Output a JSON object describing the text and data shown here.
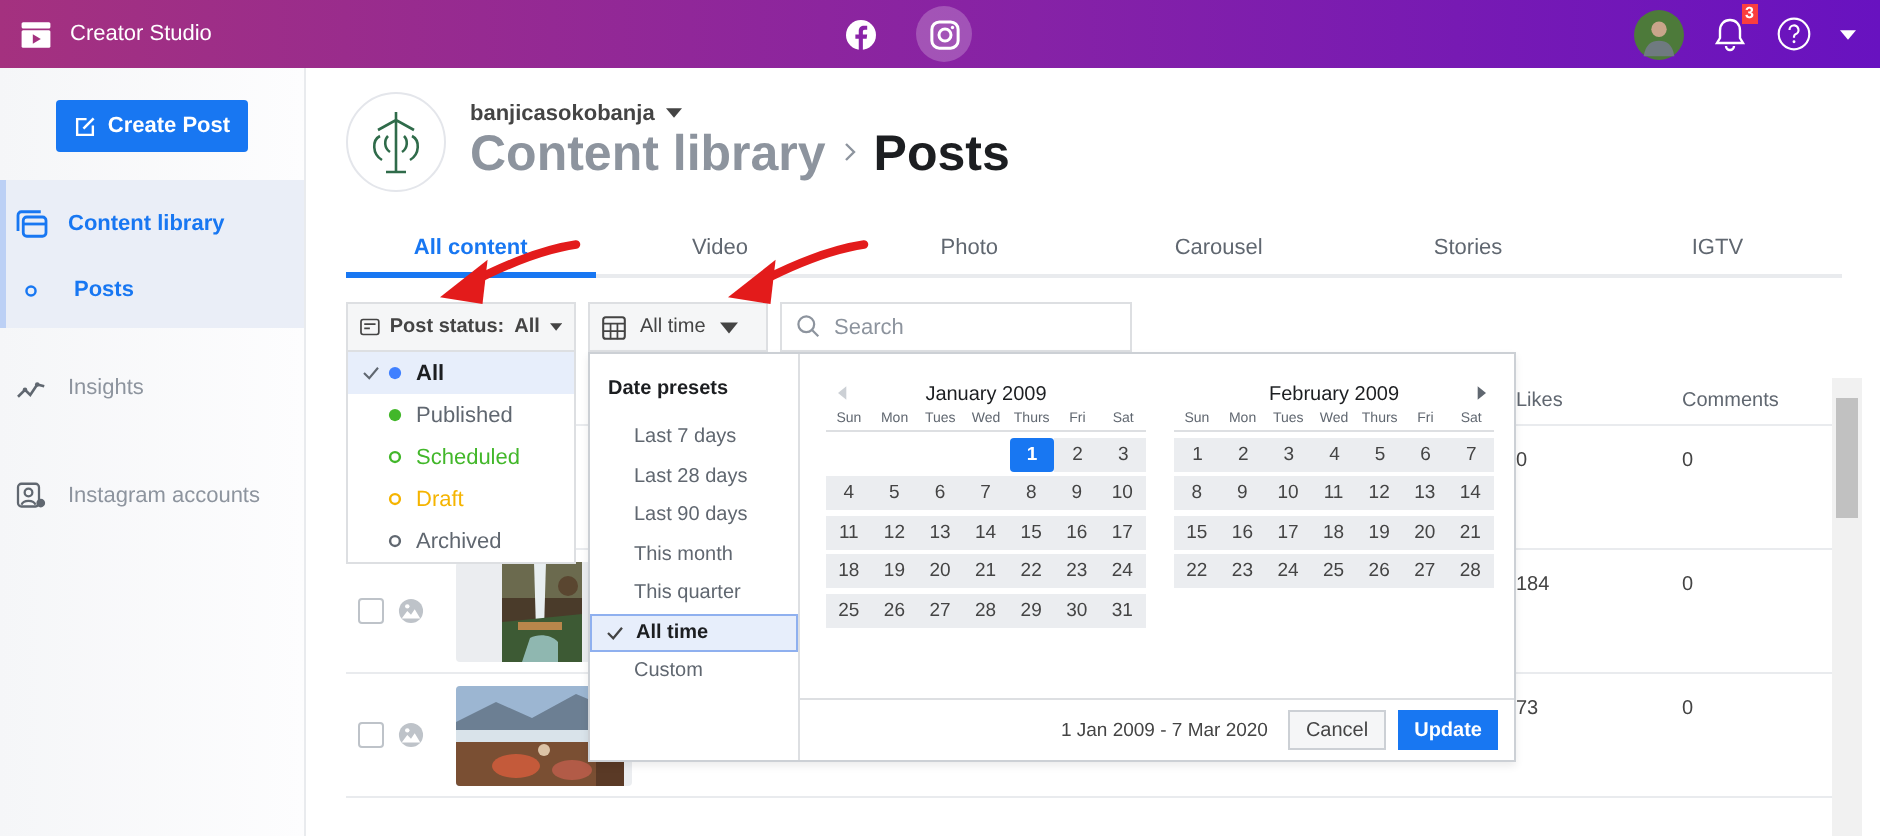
{
  "topbar": {
    "app_name": "Creator Studio",
    "platforms": [
      {
        "kind": "facebook",
        "selected": false
      },
      {
        "kind": "instagram",
        "selected": true
      }
    ],
    "notification_count": "3"
  },
  "sidebar": {
    "create_button": "Create Post",
    "items": [
      {
        "label": "Content library",
        "kind": "library",
        "selected": true,
        "children": [
          {
            "label": "Posts",
            "selected": true
          }
        ]
      },
      {
        "label": "Insights",
        "kind": "insights",
        "selected": false
      },
      {
        "label": "Instagram accounts",
        "kind": "accounts",
        "selected": false
      }
    ]
  },
  "header": {
    "username": "banjicasokobanja",
    "breadcrumb": [
      "Content library",
      "Posts"
    ]
  },
  "tabs": [
    {
      "label": "All content",
      "selected": true
    },
    {
      "label": "Video",
      "selected": false
    },
    {
      "label": "Photo",
      "selected": false
    },
    {
      "label": "Carousel",
      "selected": false
    },
    {
      "label": "Stories",
      "selected": false
    },
    {
      "label": "IGTV",
      "selected": false
    }
  ],
  "filters": {
    "status_label": "Post status:",
    "status_value": "All",
    "date_value": "All time",
    "search": {
      "placeholder": "Search"
    }
  },
  "status_menu": [
    {
      "label": "All",
      "kind": "filled",
      "color": "#4080ff",
      "selected": true
    },
    {
      "label": "Published",
      "kind": "filled",
      "color": "#42b72a",
      "selected": false
    },
    {
      "label": "Scheduled",
      "kind": "hollow",
      "color": "#42b72a",
      "selected": false
    },
    {
      "label": "Draft",
      "kind": "hollow",
      "color": "#f5b400",
      "selected": false
    },
    {
      "label": "Archived",
      "kind": "hollow",
      "color": "#606770",
      "selected": false
    }
  ],
  "date_menu": {
    "heading": "Date presets",
    "presets": [
      {
        "label": "Last 7 days",
        "selected": false
      },
      {
        "label": "Last 28 days",
        "selected": false
      },
      {
        "label": "Last 90 days",
        "selected": false
      },
      {
        "label": "This month",
        "selected": false
      },
      {
        "label": "This quarter",
        "selected": false
      },
      {
        "label": "All time",
        "selected": true
      },
      {
        "label": "Custom",
        "selected": false
      }
    ],
    "calendars": [
      {
        "month": "January 2009",
        "weekdays": [
          "Sun",
          "Mon",
          "Tues",
          "Wed",
          "Thurs",
          "Fri",
          "Sat"
        ],
        "weeks": [
          [
            {
              "d": "1",
              "selected": true
            },
            {
              "d": "2",
              "selected": false
            },
            {
              "d": "3",
              "selected": false
            }
          ],
          [
            {
              "d": "4",
              "selected": false
            },
            {
              "d": "5",
              "selected": false
            },
            {
              "d": "6",
              "selected": false
            },
            {
              "d": "7",
              "selected": false
            },
            {
              "d": "8",
              "selected": false
            },
            {
              "d": "9",
              "selected": false
            },
            {
              "d": "10",
              "selected": false
            }
          ],
          [
            {
              "d": "11",
              "selected": false
            },
            {
              "d": "12",
              "selected": false
            },
            {
              "d": "13",
              "selected": false
            },
            {
              "d": "14",
              "selected": false
            },
            {
              "d": "15",
              "selected": false
            },
            {
              "d": "16",
              "selected": false
            },
            {
              "d": "17",
              "selected": false
            }
          ],
          [
            {
              "d": "18",
              "selected": false
            },
            {
              "d": "19",
              "selected": false
            },
            {
              "d": "20",
              "selected": false
            },
            {
              "d": "21",
              "selected": false
            },
            {
              "d": "22",
              "selected": false
            },
            {
              "d": "23",
              "selected": false
            },
            {
              "d": "24",
              "selected": false
            }
          ],
          [
            {
              "d": "25",
              "selected": false
            },
            {
              "d": "26",
              "selected": false
            },
            {
              "d": "27",
              "selected": false
            },
            {
              "d": "28",
              "selected": false
            },
            {
              "d": "29",
              "selected": false
            },
            {
              "d": "30",
              "selected": false
            },
            {
              "d": "31",
              "selected": false
            }
          ]
        ]
      },
      {
        "month": "February 2009",
        "weekdays": [
          "Sun",
          "Mon",
          "Tues",
          "Wed",
          "Thurs",
          "Fri",
          "Sat"
        ],
        "weeks": [
          [
            {
              "d": "1",
              "selected": false
            },
            {
              "d": "2",
              "selected": false
            },
            {
              "d": "3",
              "selected": false
            },
            {
              "d": "4",
              "selected": false
            },
            {
              "d": "5",
              "selected": false
            },
            {
              "d": "6",
              "selected": false
            },
            {
              "d": "7",
              "selected": false
            }
          ],
          [
            {
              "d": "8",
              "selected": false
            },
            {
              "d": "9",
              "selected": false
            },
            {
              "d": "10",
              "selected": false
            },
            {
              "d": "11",
              "selected": false
            },
            {
              "d": "12",
              "selected": false
            },
            {
              "d": "13",
              "selected": false
            },
            {
              "d": "14",
              "selected": false
            }
          ],
          [
            {
              "d": "15",
              "selected": false
            },
            {
              "d": "16",
              "selected": false
            },
            {
              "d": "17",
              "selected": false
            },
            {
              "d": "18",
              "selected": false
            },
            {
              "d": "19",
              "selected": false
            },
            {
              "d": "20",
              "selected": false
            },
            {
              "d": "21",
              "selected": false
            }
          ],
          [
            {
              "d": "22",
              "selected": false
            },
            {
              "d": "23",
              "selected": false
            },
            {
              "d": "24",
              "selected": false
            },
            {
              "d": "25",
              "selected": false
            },
            {
              "d": "26",
              "selected": false
            },
            {
              "d": "27",
              "selected": false
            },
            {
              "d": "28",
              "selected": false
            }
          ]
        ]
      }
    ],
    "range": "1 Jan 2009 - 7 Mar 2020",
    "cancel": "Cancel",
    "update": "Update"
  },
  "table": {
    "columns": [
      "Likes",
      "Comments"
    ],
    "rows": [
      {
        "likes": "0",
        "comments": "0"
      },
      {
        "checked": false,
        "likes": "184",
        "comments": "0"
      },
      {
        "checked": false,
        "likes": "73",
        "comments": "0"
      }
    ]
  }
}
